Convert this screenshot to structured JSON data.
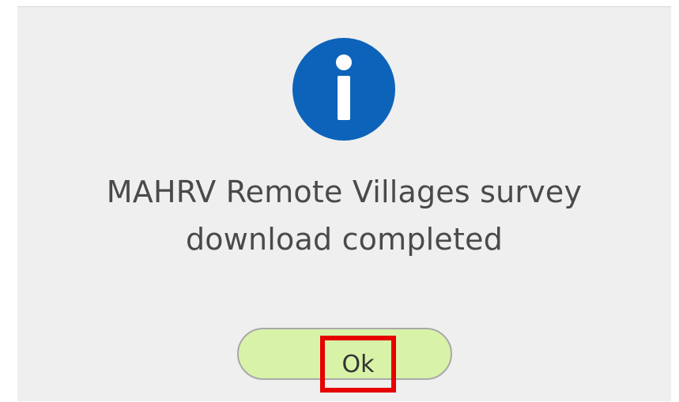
{
  "dialog": {
    "icon": "info-icon",
    "accent_color": "#0d63ba",
    "message_line1": "MAHRV Remote Villages survey",
    "message_line2": "download completed",
    "ok_label": "Ok",
    "ok_button_color": "#d8f3a8",
    "highlight_color": "#e60000"
  }
}
